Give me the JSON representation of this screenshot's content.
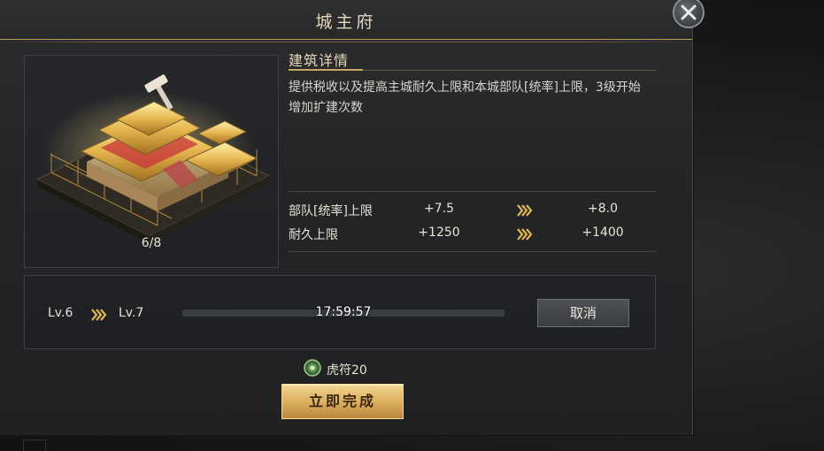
{
  "dialog": {
    "title": "城主府",
    "close_icon": "close-icon"
  },
  "preview": {
    "build_progress": "6/8",
    "image": "palace-building-under-construction"
  },
  "details": {
    "section_title": "建筑详情",
    "description": "提供税收以及提高主城耐久上限和本城部队[统率]上限，3级开始增加扩建次数",
    "stats": [
      {
        "name": "部队[统率]上限",
        "current": "+7.5",
        "next": "+8.0"
      },
      {
        "name": "耐久上限",
        "current": "+1250",
        "next": "+1400"
      }
    ]
  },
  "upgrade": {
    "from_level": "Lv.6",
    "to_level": "Lv.7",
    "timer": "17:59:57",
    "cancel_label": "取消"
  },
  "cost": {
    "icon": "tiger-tally-icon",
    "label": "虎符20"
  },
  "finish_label": "立即完成",
  "colors": {
    "gold_accent": "#c7a663",
    "finish_button": "#d9ad5c",
    "arrow_gold": "#e0b652",
    "text": "#e8e2d4"
  }
}
